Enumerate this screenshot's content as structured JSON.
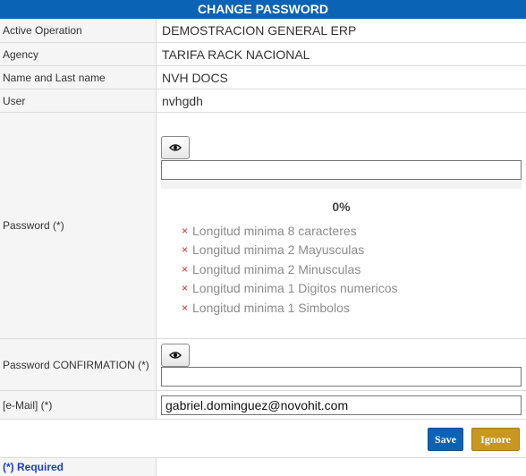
{
  "title": "CHANGE PASSWORD",
  "fields": {
    "active_operation": {
      "label": "Active Operation",
      "value": "DEMOSTRACION GENERAL ERP"
    },
    "agency": {
      "label": "Agency",
      "value": "TARIFA RACK NACIONAL"
    },
    "name": {
      "label": "Name and Last name",
      "value": "NVH DOCS"
    },
    "user": {
      "label": "User",
      "value": "nvhgdh"
    },
    "password": {
      "label": "Password (*)",
      "value": ""
    },
    "password_confirmation": {
      "label": "Password CONFIRMATION (*)",
      "value": ""
    },
    "email": {
      "label": "[e-Mail] (*)",
      "value": "gabriel.dominguez@novohit.com"
    }
  },
  "strength": {
    "percent_label": "0%",
    "fraction": 0,
    "rules": [
      "Longitud minima 8 caracteres",
      "Longitud minima 2 Mayusculas",
      "Longitud minima 2 Minusculas",
      "Longitud minima 1 Digitos numericos",
      "Longitud minima 1 Simbolos"
    ],
    "rule_mark": "×"
  },
  "buttons": {
    "save": "Save",
    "ignore": "Ignore"
  },
  "footer": {
    "required_note": "(*) Required"
  },
  "colors": {
    "header": "#0b63b6",
    "save": "#0b63b6",
    "ignore": "#c9961e",
    "rule_fail": "#d9252a",
    "required": "#1e3ec7"
  },
  "icons": {
    "toggle_visibility": "eye-icon"
  }
}
